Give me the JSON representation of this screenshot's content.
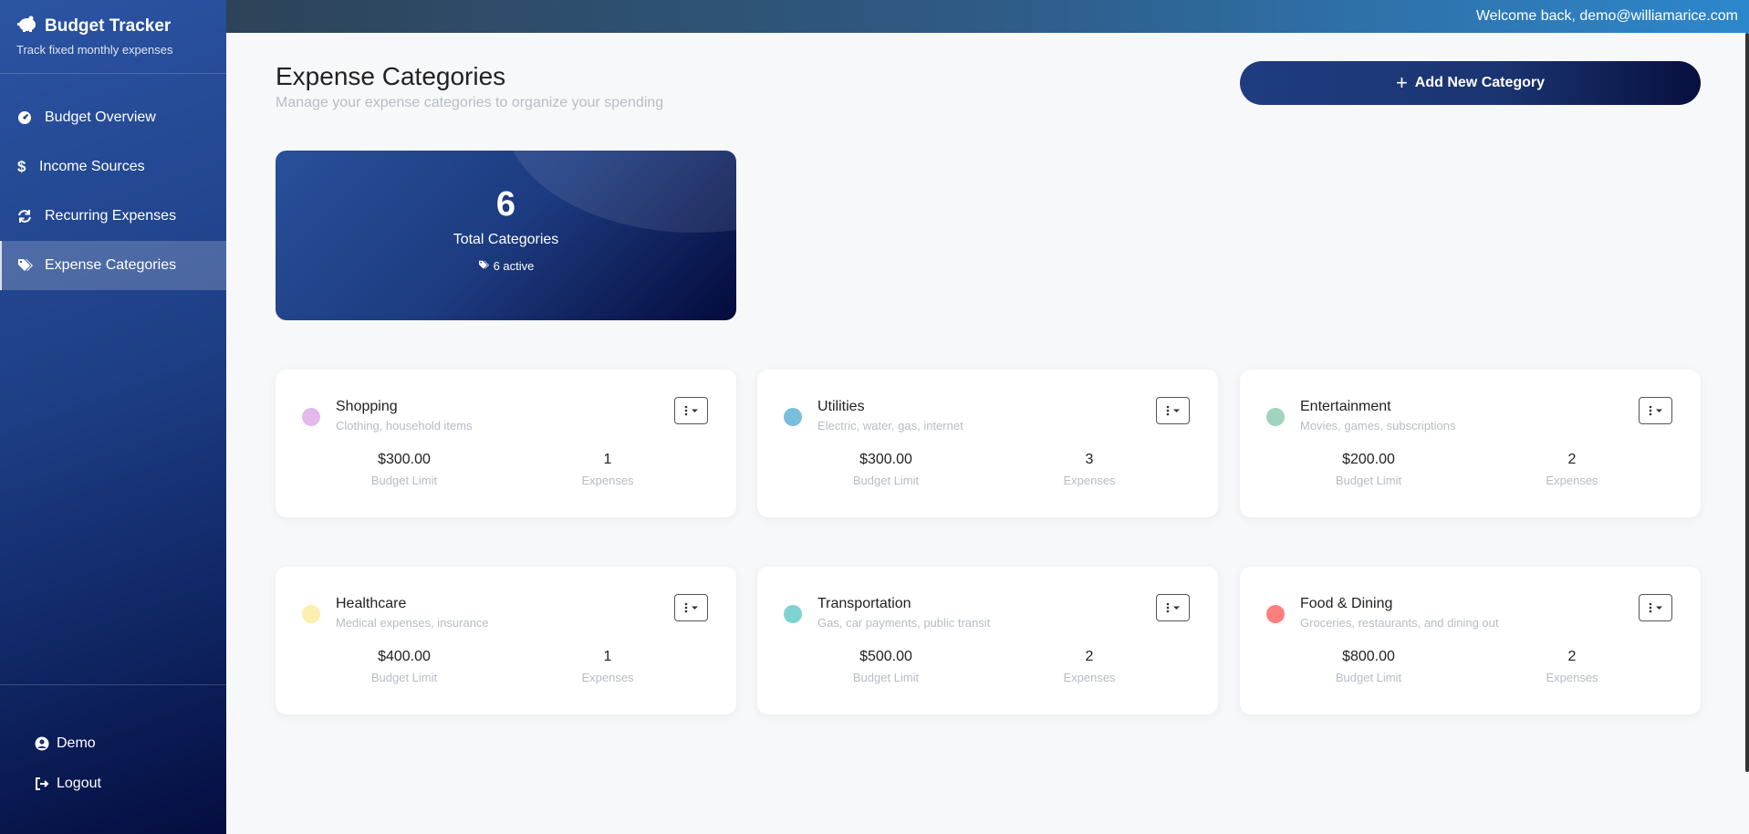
{
  "app": {
    "title": "Budget Tracker",
    "subtitle": "Track fixed monthly expenses"
  },
  "nav": [
    {
      "label": "Budget Overview",
      "icon": "gauge-icon"
    },
    {
      "label": "Income Sources",
      "icon": "dollar-icon"
    },
    {
      "label": "Recurring Expenses",
      "icon": "repeat-icon"
    },
    {
      "label": "Expense Categories",
      "icon": "tags-icon",
      "active": true
    }
  ],
  "user": {
    "name": "Demo",
    "logout": "Logout"
  },
  "topbar": {
    "welcome": "Welcome back, demo@williamarice.com"
  },
  "page": {
    "title": "Expense Categories",
    "subtitle": "Manage your expense categories to organize your spending",
    "add_button": "Add New Category"
  },
  "summary": {
    "total": "6",
    "label": "Total Categories",
    "active": "6 active"
  },
  "labels": {
    "budget": "Budget Limit",
    "expenses": "Expenses"
  },
  "categories": [
    {
      "name": "Shopping",
      "description": "Clothing, household items",
      "budget": "$300.00",
      "expenses": "1",
      "color": "#d08ae0"
    },
    {
      "name": "Utilities",
      "description": "Electric, water, gas, internet",
      "budget": "$300.00",
      "expenses": "3",
      "color": "#1f93c4"
    },
    {
      "name": "Entertainment",
      "description": "Movies, games, subscriptions",
      "budget": "$200.00",
      "expenses": "2",
      "color": "#62b892"
    },
    {
      "name": "Healthcare",
      "description": "Medical expenses, insurance",
      "budget": "$400.00",
      "expenses": "1",
      "color": "#fde27a"
    },
    {
      "name": "Transportation",
      "description": "Gas, car payments, public transit",
      "budget": "$500.00",
      "expenses": "2",
      "color": "#27b5b0"
    },
    {
      "name": "Food & Dining",
      "description": "Groceries, restaurants, and dining out",
      "budget": "$800.00",
      "expenses": "2",
      "color": "#ff2a2a"
    }
  ]
}
